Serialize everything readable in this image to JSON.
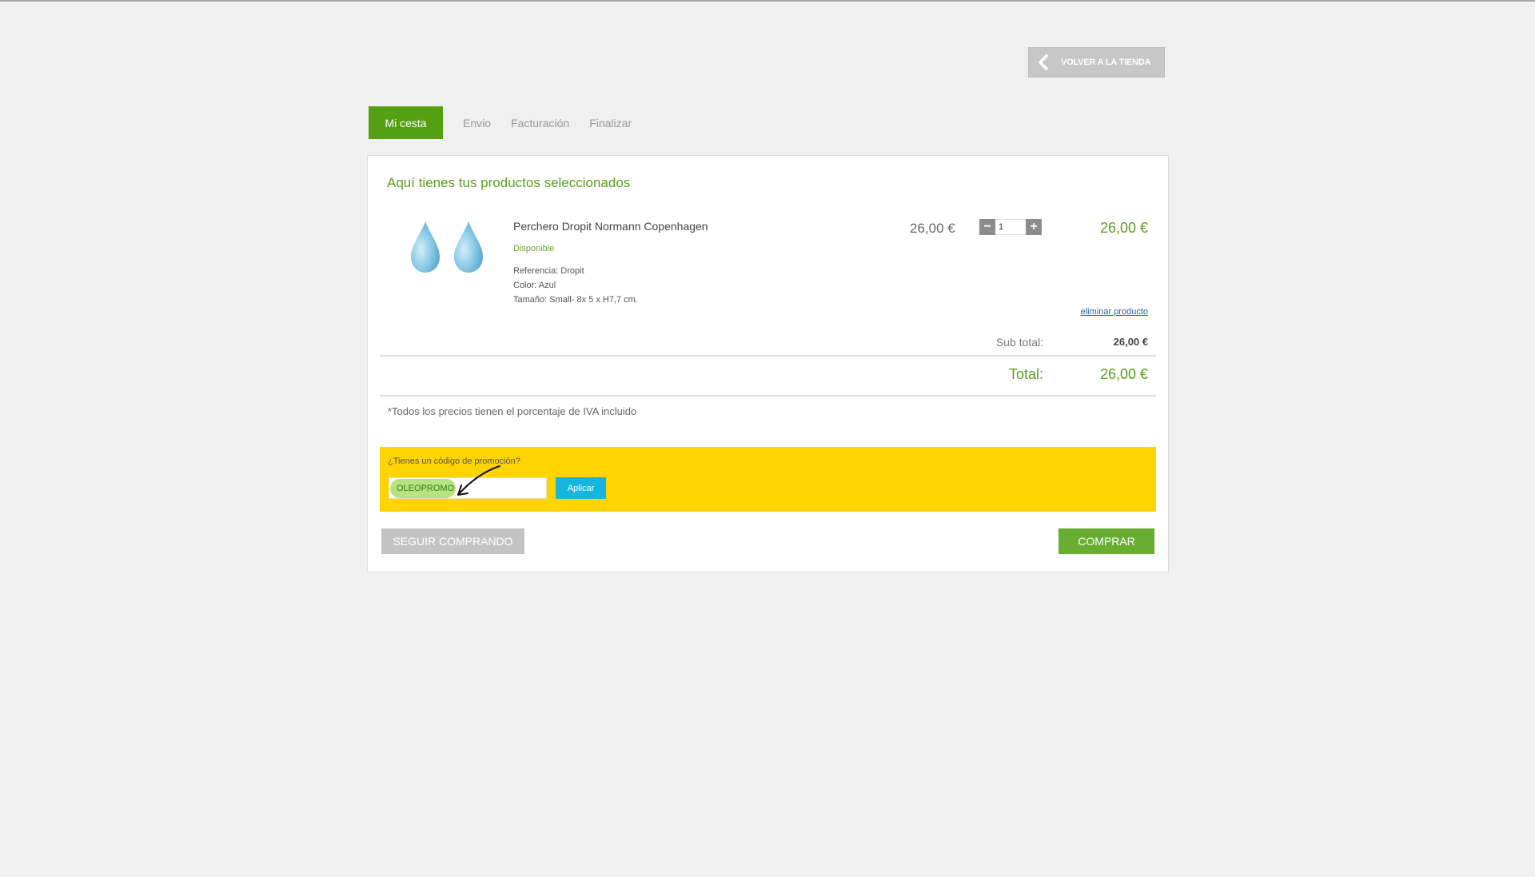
{
  "header": {
    "back_label": "VOLVER A LA TIENDA",
    "back_icon": "chevron-left-icon"
  },
  "steps": {
    "active": "Mi cesta",
    "items": [
      "Envio",
      "Facturación",
      "Finalizar"
    ]
  },
  "cart": {
    "title": "Aquí tienes tus productos seleccionados",
    "product": {
      "image_icon": "water-drop-icon",
      "name": "Perchero Dropit Normann Copenhagen",
      "availability": "Disponible",
      "reference": "Referencia: Dropit",
      "color": "Color: Azul",
      "size": "Tamaño: Small- 8x 5 x H7,7 cm.",
      "unit_price": "26,00 €",
      "quantity": "1",
      "line_total": "26,00 €",
      "remove_label": "eliminar producto"
    },
    "subtotal_label": "Sub total:",
    "subtotal_value": "26,00 €",
    "total_label": "Total:",
    "total_value": "26,00 €",
    "vat_note": "*Todos los precios tienen el porcentaje de IVA incluido"
  },
  "promo": {
    "question": "¿Tienes un código de promoción?",
    "code_value": "OLEOPROMO",
    "apply_label": "Aplicar"
  },
  "actions": {
    "keep_shopping_label": "SEGUIR COMPRANDO",
    "buy_label": "COMPRAR"
  },
  "colors": {
    "accent_green": "#55a012",
    "promo_yellow": "#ffd400",
    "apply_blue": "#15b5e0",
    "buy_green": "#69ad33"
  }
}
